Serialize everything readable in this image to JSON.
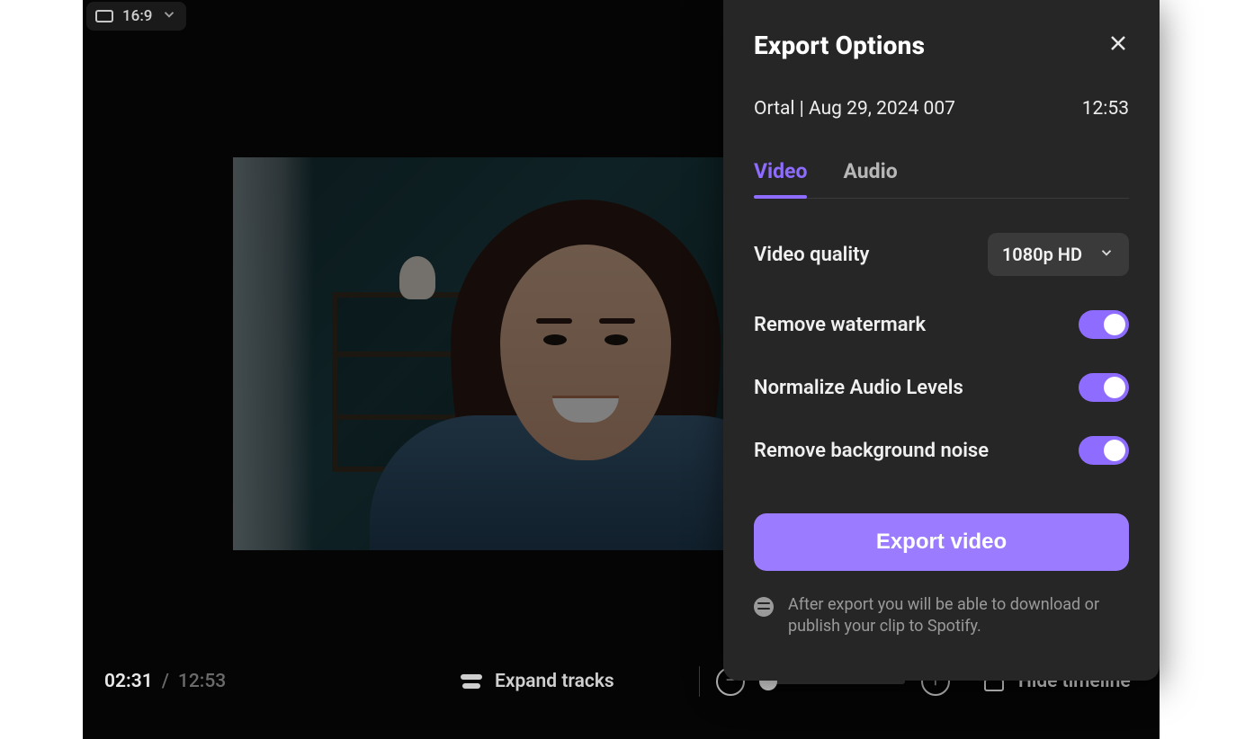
{
  "toolbar": {
    "aspect_ratio": "16:9"
  },
  "timeline": {
    "current": "02:31",
    "separator": "/",
    "total": "12:53",
    "expand_label": "Expand tracks",
    "hide_label": "Hide timeline"
  },
  "export": {
    "title": "Export Options",
    "filename": "Ortal | Aug 29, 2024 007",
    "duration": "12:53",
    "tabs": {
      "video": "Video",
      "audio": "Audio"
    },
    "quality_label": "Video quality",
    "quality_value": "1080p HD",
    "options": {
      "watermark": "Remove watermark",
      "normalize": "Normalize Audio Levels",
      "noise": "Remove background noise"
    },
    "button": "Export video",
    "footer": "After export you will be able to download or publish your clip to Spotify."
  },
  "colors": {
    "accent": "#8e6cff"
  }
}
